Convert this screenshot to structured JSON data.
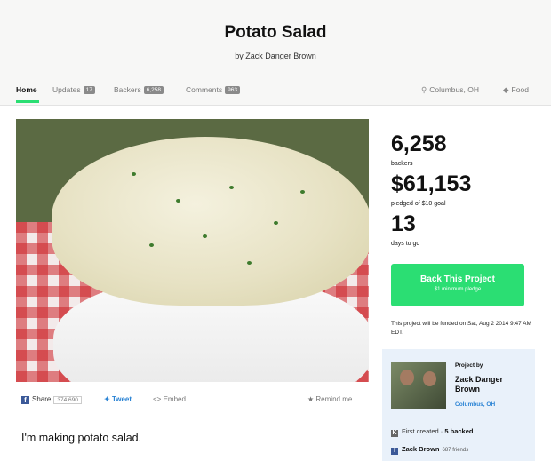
{
  "header": {
    "title": "Potato Salad",
    "byline": "by Zack Danger Brown"
  },
  "nav": {
    "home": "Home",
    "updates": "Updates",
    "updates_count": "17",
    "backers": "Backers",
    "backers_count": "6,258",
    "comments": "Comments",
    "comments_count": "963",
    "location": "Columbus, OH",
    "category": "Food"
  },
  "stats": {
    "backers_value": "6,258",
    "backers_label": "backers",
    "pledged_value": "$61,153",
    "pledged_label": "pledged of $10 goal",
    "days_value": "13",
    "days_label": "days to go"
  },
  "back_button": {
    "label": "Back This Project",
    "sub": "$1 minimum pledge"
  },
  "funded_note": "This project will be funded on Sat, Aug 2 2014 9:47 AM EDT.",
  "creator": {
    "project_by": "Project by",
    "name": "Zack Danger Brown",
    "location": "Columbus, OH",
    "first_created": "First created",
    "backed": "5 backed",
    "fb_name": "Zack Brown",
    "fb_friends": "687 friends"
  },
  "share": {
    "share_label": "Share",
    "share_count": "374,690",
    "tweet_label": "Tweet",
    "embed_label": "Embed",
    "remind_label": "Remind me"
  },
  "description": "I'm making potato salad.",
  "colors": {
    "accent": "#2bde73",
    "link": "#2a83d4",
    "facebook": "#3b5998"
  }
}
